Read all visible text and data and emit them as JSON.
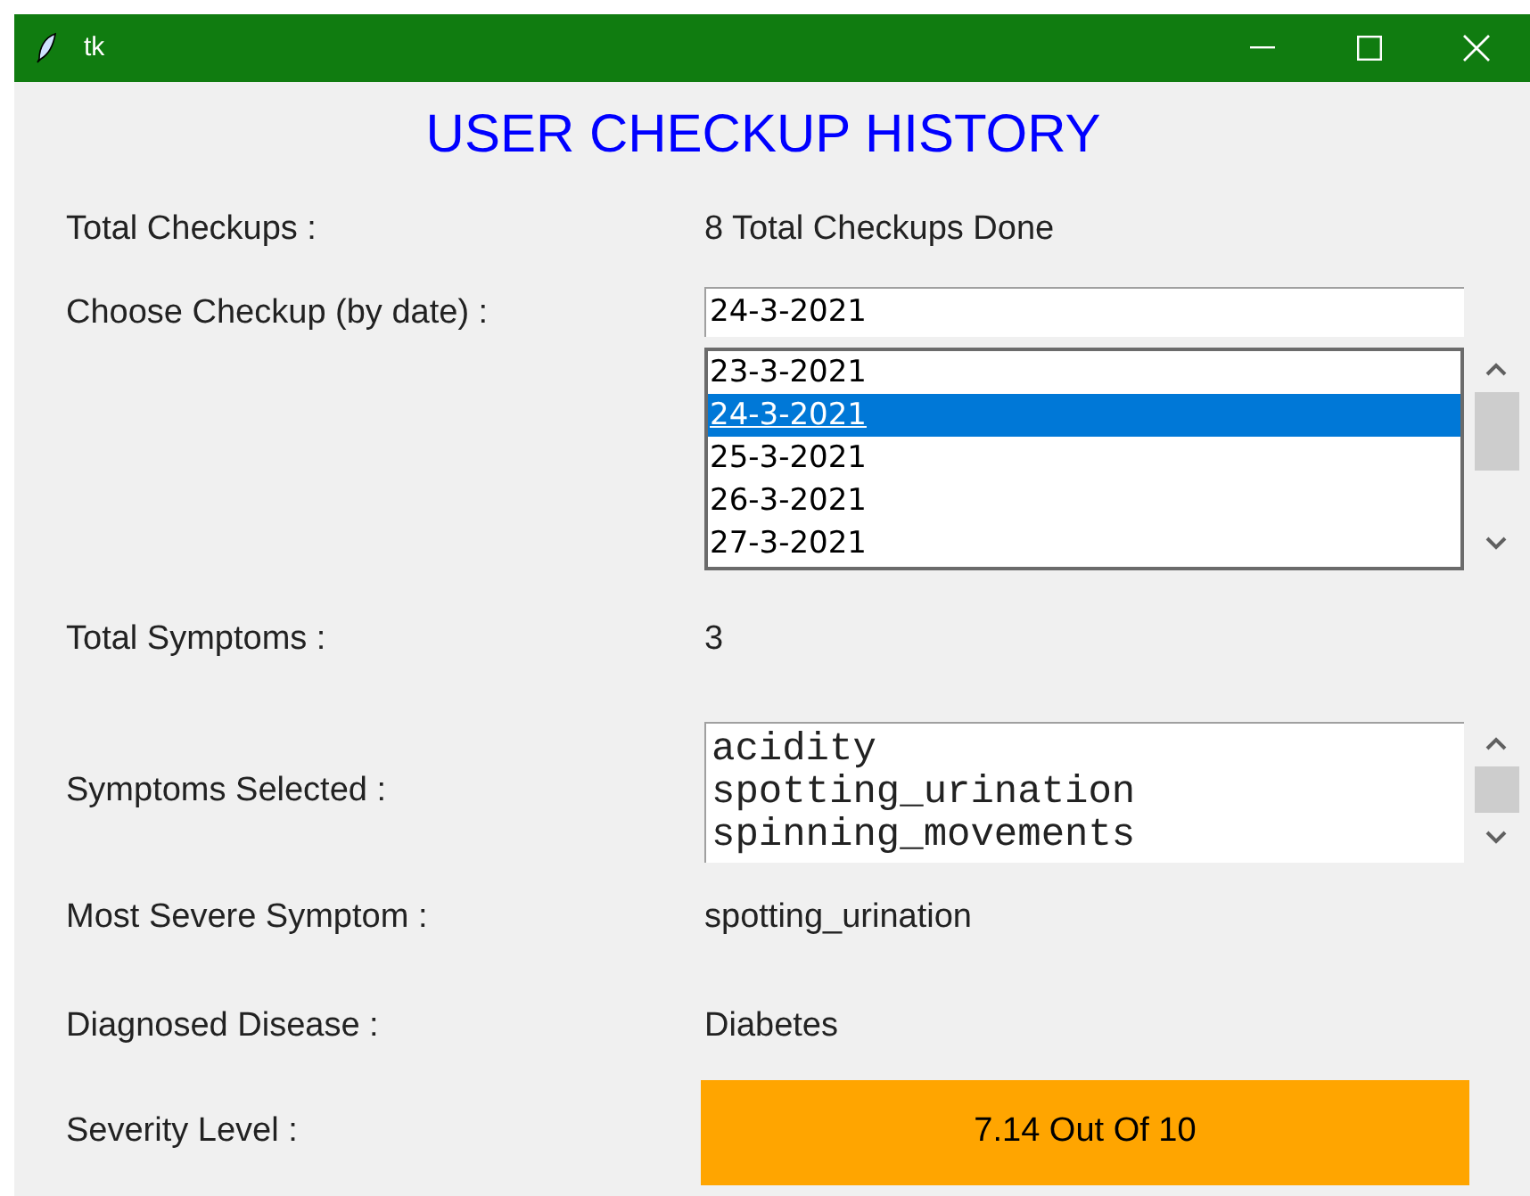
{
  "window": {
    "title": "tk"
  },
  "heading": "USER CHECKUP HISTORY",
  "total_checkups": {
    "label": "Total Checkups :",
    "value": "8 Total Checkups Done"
  },
  "choose_checkup": {
    "label": "Choose Checkup (by date) :",
    "entry_value": "24-3-2021",
    "dates": [
      {
        "text": "23-3-2021",
        "selected": false
      },
      {
        "text": "24-3-2021",
        "selected": true
      },
      {
        "text": "25-3-2021",
        "selected": false
      },
      {
        "text": "26-3-2021",
        "selected": false
      },
      {
        "text": "27-3-2021",
        "selected": false
      }
    ]
  },
  "total_symptoms": {
    "label": "Total Symptoms :",
    "value": "3"
  },
  "symptoms_selected": {
    "label": "Symptoms Selected :",
    "items": [
      "acidity",
      "spotting_urination",
      "spinning_movements"
    ]
  },
  "most_severe_symptom": {
    "label": "Most Severe Symptom :",
    "value": "spotting_urination"
  },
  "diagnosed_disease": {
    "label": "Diagnosed Disease :",
    "value": "Diabetes"
  },
  "severity_level": {
    "label": "Severity Level :",
    "value": "7.14 Out Of 10"
  }
}
